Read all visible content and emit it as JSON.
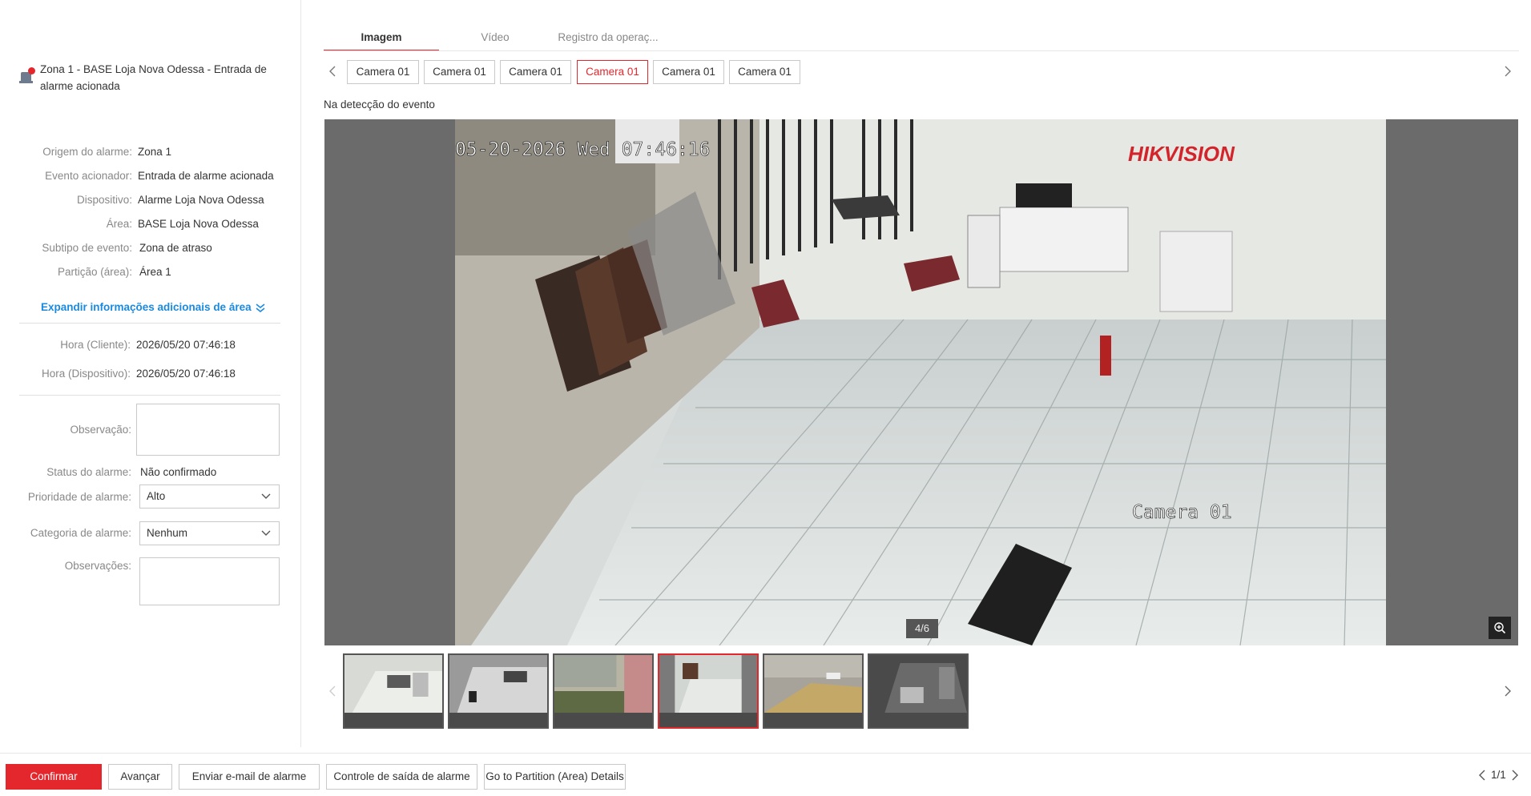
{
  "alarm": {
    "title": "Zona 1 - BASE Loja Nova Odessa - Entrada de alarme acionada",
    "icon": "alarm-zone-icon",
    "status_dot_color": "#e4262d"
  },
  "details": [
    {
      "label": "Origem do alarme:",
      "value": "Zona 1"
    },
    {
      "label": "Evento acionador:",
      "value": "Entrada de alarme acionada"
    },
    {
      "label": "Dispositivo:",
      "value": "Alarme Loja Nova Odessa"
    },
    {
      "label": "Área:",
      "value": "BASE Loja Nova Odessa"
    },
    {
      "label": "Subtipo de evento:",
      "value": "Zona de atraso"
    },
    {
      "label": "Partição (área):",
      "value": "Área 1"
    }
  ],
  "expand_label": "Expandir informações adicionais de área",
  "times": [
    {
      "label": "Hora (Cliente):",
      "value": "2026/05/20 07:46:18"
    },
    {
      "label": "Hora (Dispositivo):",
      "value": "2026/05/20 07:46:18"
    }
  ],
  "form": {
    "observation_label": "Observação:",
    "observation_value": "",
    "status_label": "Status do alarme:",
    "status_value": "Não confirmado",
    "priority_label": "Prioridade de alarme:",
    "priority_value": "Alto",
    "category_label": "Categoria de alarme:",
    "category_value": "Nenhum",
    "notes_label": "Observações:",
    "notes_value": ""
  },
  "tabs": [
    {
      "label": "Imagem",
      "active": true
    },
    {
      "label": "Vídeo",
      "active": false
    },
    {
      "label": "Registro da operaç...",
      "active": false
    }
  ],
  "cameras": [
    {
      "label": "Camera 01",
      "active": false
    },
    {
      "label": "Camera 01",
      "active": false
    },
    {
      "label": "Camera 01",
      "active": false
    },
    {
      "label": "Camera 01",
      "active": true
    },
    {
      "label": "Camera 01",
      "active": false
    },
    {
      "label": "Camera 01",
      "active": false
    }
  ],
  "caption": "Na detecção do evento",
  "viewer": {
    "osd_timestamp": "05-20-2026 Wed 07:46:16",
    "osd_brand": "HIKVISION",
    "osd_camera": "Camera 01",
    "counter": "4/6"
  },
  "thumbnails": [
    {
      "active": false
    },
    {
      "active": false
    },
    {
      "active": false
    },
    {
      "active": true
    },
    {
      "active": false
    },
    {
      "active": false
    }
  ],
  "footer": {
    "confirm": "Confirmar",
    "next": "Avançar",
    "email": "Enviar e-mail de alarme",
    "output": "Controle de saída de alarme",
    "partition": "Go to Partition (Area) Details",
    "page": "1/1"
  },
  "colors": {
    "accent": "#e4262d",
    "link": "#1a8ae0"
  }
}
